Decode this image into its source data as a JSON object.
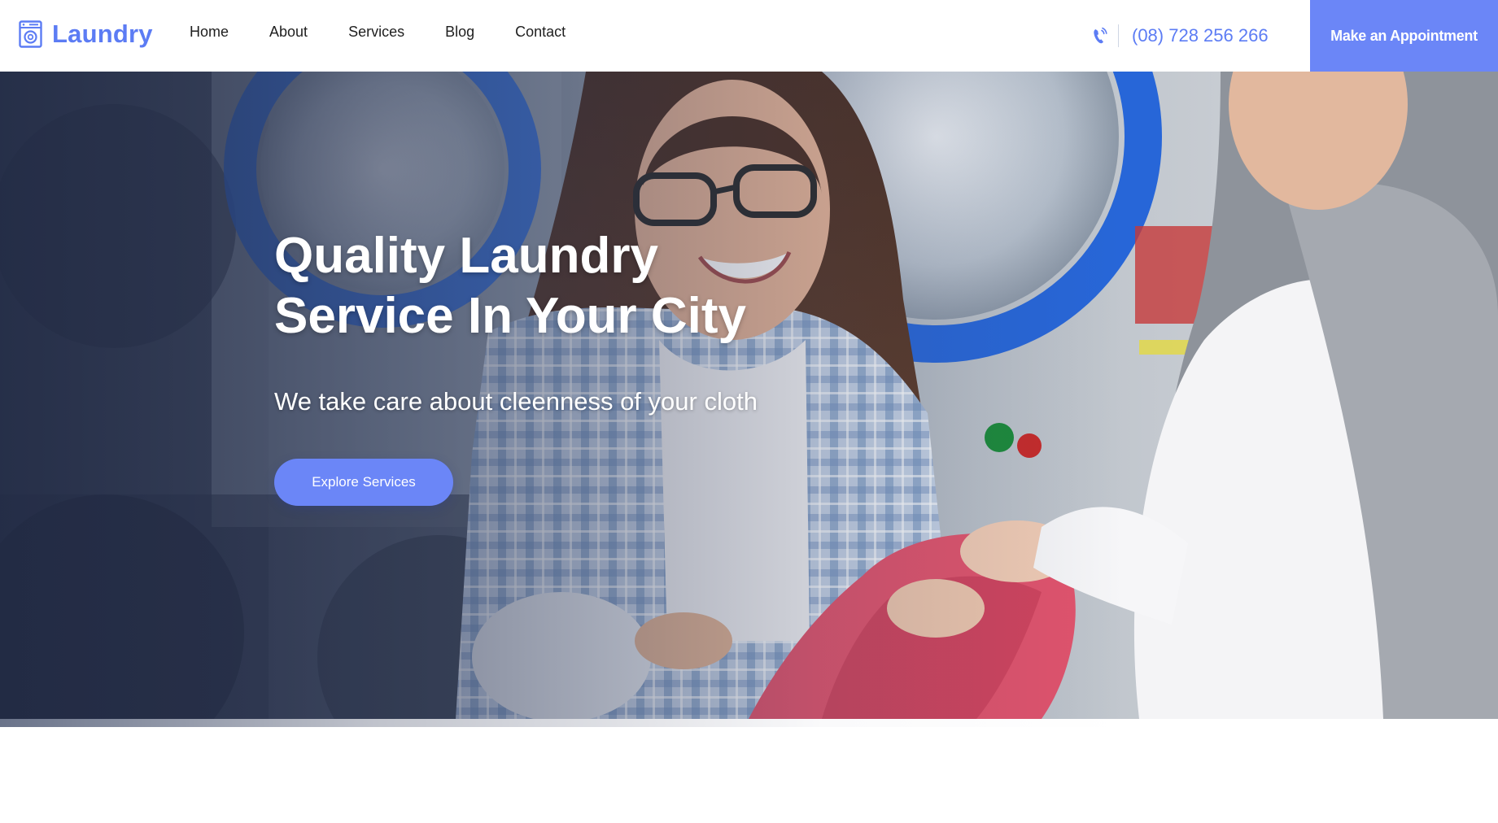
{
  "header": {
    "brand": {
      "name": "Laundry",
      "icon": "washing-machine-icon"
    },
    "nav": [
      {
        "label": "Home"
      },
      {
        "label": "About"
      },
      {
        "label": "Services"
      },
      {
        "label": "Blog"
      },
      {
        "label": "Contact"
      }
    ],
    "phone": {
      "icon": "phone-ringing-icon",
      "number": "(08) 728 256 266"
    },
    "cta_label": "Make an Appointment"
  },
  "hero": {
    "title_line1": "Quality Laundry",
    "title_line2": "Service In Your City",
    "subtitle": "We take care about cleenness of your cloth",
    "button_label": "Explore Services",
    "image": "laundromat-photo"
  },
  "colors": {
    "accent": "#6b86f7",
    "brand_text": "#5c7cf4",
    "nav_text": "#1f1f1f",
    "hero_overlay": "#212a45"
  }
}
